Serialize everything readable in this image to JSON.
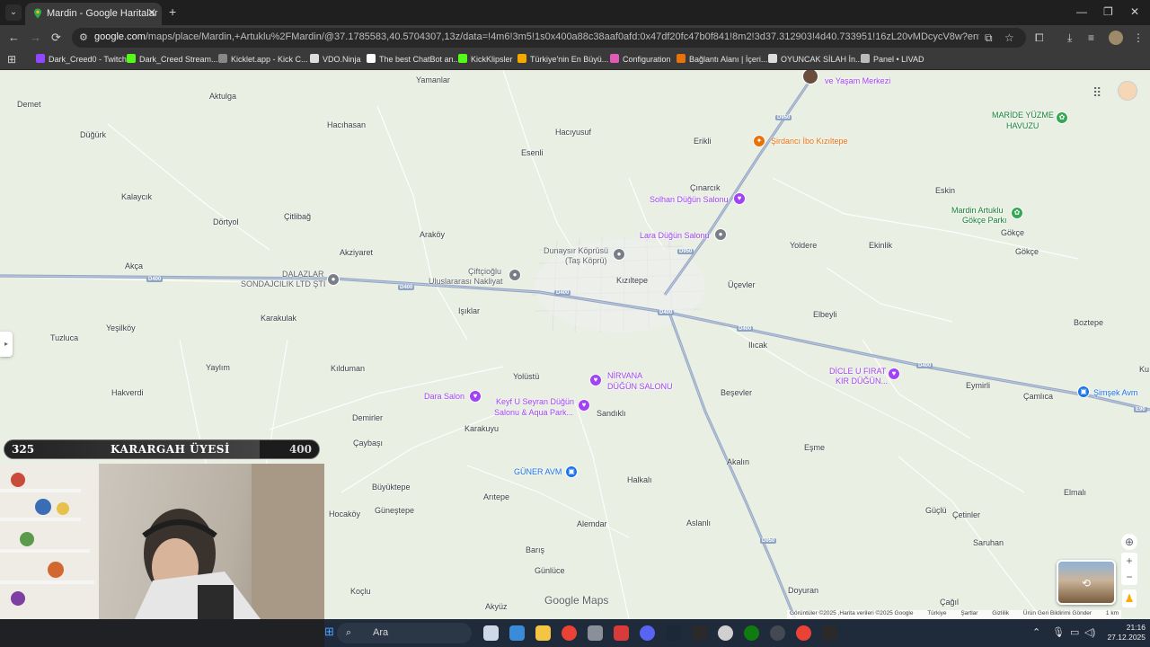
{
  "browser": {
    "tab_title": "Mardin - Google Haritalar",
    "tab_close": "✕",
    "new_tab": "+",
    "url_host": "google.com",
    "url_path": "/maps/place/Mardin,+Artuklu%2FMardin/@37.1785583,40.5704307,13z/data=!4m6!3m5!1s0x400a88c38aaf0afd:0x47df20fc47b0f841!8m2!3d37.312903!4d40.733951!16zL20vMDcycV8w?entry=ttu&g_ep=EgoyMDI1MTIwOS4wI..."
  },
  "bookmarks": [
    {
      "label": "Dark_Creed0 - Twitch",
      "color": "#9146ff"
    },
    {
      "label": "Dark_Creed Stream...",
      "color": "#53fc18"
    },
    {
      "label": "Kicklet.app - Kick C...",
      "color": "#888888"
    },
    {
      "label": "VDO.Ninja",
      "color": "#dddddd"
    },
    {
      "label": "The best ChatBot an...",
      "color": "#ffffff"
    },
    {
      "label": "KickKlipsler",
      "color": "#53fc18"
    },
    {
      "label": "Türkiye'nin En Büyü...",
      "color": "#f2a900"
    },
    {
      "label": "Configuration",
      "color": "#e05ab8"
    },
    {
      "label": "Bağlantı Alanı | İçeri...",
      "color": "#e8710a"
    },
    {
      "label": "OYUNCAK SİLAH İn...",
      "color": "#dddddd"
    },
    {
      "label": "Panel • LIVAD",
      "color": "#bbbbbb"
    }
  ],
  "map": {
    "places": [
      {
        "label": "Yamanlar",
        "cls": ""
      },
      {
        "label": "Aktulga",
        "cls": ""
      },
      {
        "label": "Demet",
        "cls": ""
      },
      {
        "label": "Düğürk",
        "cls": ""
      },
      {
        "label": "Hacıhasan",
        "cls": ""
      },
      {
        "label": "Hacıyusuf",
        "cls": ""
      },
      {
        "label": "Esenli",
        "cls": ""
      },
      {
        "label": "Erikli",
        "cls": ""
      },
      {
        "label": "Kalaycık",
        "cls": ""
      },
      {
        "label": "Dörtyol",
        "cls": ""
      },
      {
        "label": "Çitlibağ",
        "cls": ""
      },
      {
        "label": "Akziyaret",
        "cls": ""
      },
      {
        "label": "Araköy",
        "cls": ""
      },
      {
        "label": "Çınarcık",
        "cls": ""
      },
      {
        "label": "Eskin",
        "cls": ""
      },
      {
        "label": "Gökçe",
        "cls": ""
      },
      {
        "label": "Gökçe",
        "cls": ""
      },
      {
        "label": "Yoldere",
        "cls": ""
      },
      {
        "label": "Ekinlik",
        "cls": ""
      },
      {
        "label": "Akça",
        "cls": ""
      },
      {
        "label": "Kızıltepe",
        "cls": ""
      },
      {
        "label": "Üçevler",
        "cls": ""
      },
      {
        "label": "Işıklar",
        "cls": ""
      },
      {
        "label": "Karakulak",
        "cls": ""
      },
      {
        "label": "Elbeyli",
        "cls": ""
      },
      {
        "label": "Boztepe",
        "cls": ""
      },
      {
        "label": "Yeşilköy",
        "cls": ""
      },
      {
        "label": "Tuzluca",
        "cls": ""
      },
      {
        "label": "Ilıcak",
        "cls": ""
      },
      {
        "label": "Yaylım",
        "cls": ""
      },
      {
        "label": "Kılduman",
        "cls": ""
      },
      {
        "label": "Yolüstü",
        "cls": ""
      },
      {
        "label": "Eymirli",
        "cls": ""
      },
      {
        "label": "Çamlıca",
        "cls": ""
      },
      {
        "label": "Hakverdi",
        "cls": ""
      },
      {
        "label": "Beşevler",
        "cls": ""
      },
      {
        "label": "Sandıklı",
        "cls": ""
      },
      {
        "label": "Demirler",
        "cls": ""
      },
      {
        "label": "Karakuyu",
        "cls": ""
      },
      {
        "label": "Çaybaşı",
        "cls": ""
      },
      {
        "label": "Eşme",
        "cls": ""
      },
      {
        "label": "Akalın",
        "cls": ""
      },
      {
        "label": "Büyüktepe",
        "cls": ""
      },
      {
        "label": "Halkalı",
        "cls": ""
      },
      {
        "label": "Elmalı",
        "cls": ""
      },
      {
        "label": "Arıtepe",
        "cls": ""
      },
      {
        "label": "Hocaköy",
        "cls": ""
      },
      {
        "label": "Güneştepe",
        "cls": ""
      },
      {
        "label": "Güçlü",
        "cls": ""
      },
      {
        "label": "Çetinler",
        "cls": ""
      },
      {
        "label": "Alemdar",
        "cls": ""
      },
      {
        "label": "Aslanlı",
        "cls": ""
      },
      {
        "label": "Barış",
        "cls": ""
      },
      {
        "label": "Saruhan",
        "cls": ""
      },
      {
        "label": "Günlüce",
        "cls": ""
      },
      {
        "label": "Koçlu",
        "cls": ""
      },
      {
        "label": "Doyuran",
        "cls": ""
      },
      {
        "label": "Akyüz",
        "cls": ""
      },
      {
        "label": "Çağıl",
        "cls": ""
      },
      {
        "label": "Ku",
        "cls": ""
      },
      {
        "label": "Dunaysır Köprüsü",
        "cls": "poi-gray"
      },
      {
        "label": "(Taş Köprü)",
        "cls": "poi-gray"
      },
      {
        "label": "Lara Düğün Salonu",
        "cls": "poi-purple"
      },
      {
        "label": "Solhan Düğün Salonu",
        "cls": "poi-purple"
      },
      {
        "label": "Şirdancı İbo Kızıltepe",
        "cls": "poi-orange"
      },
      {
        "label": "Çiftçioğlu",
        "cls": "poi-gray"
      },
      {
        "label": "Uluslararası Nakliyat",
        "cls": "poi-gray"
      },
      {
        "label": "DALAZLAR",
        "cls": "poi-gray"
      },
      {
        "label": "SONDAJCILIK LTD ŞTİ",
        "cls": "poi-gray"
      },
      {
        "label": "NİRVANA",
        "cls": "poi-purple"
      },
      {
        "label": "DÜĞÜN SALONU",
        "cls": "poi-purple"
      },
      {
        "label": "Dara Salon",
        "cls": "poi-purple"
      },
      {
        "label": "Keyf U Seyran Düğün",
        "cls": "poi-purple"
      },
      {
        "label": "Salonu & Aqua Park...",
        "cls": "poi-purple"
      },
      {
        "label": "GÜNER AVM",
        "cls": "poi-blue"
      },
      {
        "label": "DİCLE U FIRAT",
        "cls": "poi-purple"
      },
      {
        "label": "KIR DÜĞÜN...",
        "cls": "poi-purple"
      },
      {
        "label": "Şimşek Avm",
        "cls": "poi-blue"
      },
      {
        "label": "MARİDE YÜZME",
        "cls": "poi-green"
      },
      {
        "label": "HAVUZU",
        "cls": "poi-green"
      },
      {
        "label": "Mardin Artuklu",
        "cls": "poi-green"
      },
      {
        "label": "Gökçe Parkı",
        "cls": "poi-green"
      },
      {
        "label": "ve Yaşam Merkezi",
        "cls": "poi-purple"
      }
    ],
    "road_labels": [
      "D400",
      "D400",
      "D400",
      "D400",
      "D400",
      "D400",
      "D950",
      "D950",
      "D950",
      "E90"
    ],
    "logo": "Google Maps",
    "attribution": [
      "Görüntüler ©2025 ,Harita verileri ©2025 Google",
      "Türkiye",
      "Şartlar",
      "Gizlilik",
      "Ürün Geri Bildirimi Gönder",
      "1 km"
    ]
  },
  "overlay": {
    "goal_current": "325",
    "goal_title": "KARARGAH ÜYESİ",
    "goal_max": "400",
    "goal_fraction": 0.8125
  },
  "taskbar": {
    "search_label": "Ara",
    "time": "21:16",
    "date": "27.12.2025",
    "apps": [
      {
        "name": "task-view",
        "color": "#cfd8e6"
      },
      {
        "name": "store",
        "color": "#3a8bd8"
      },
      {
        "name": "file-explorer",
        "color": "#f4c542"
      },
      {
        "name": "chrome",
        "color": "#ea4335"
      },
      {
        "name": "app-box",
        "color": "#8a8f98"
      },
      {
        "name": "app-red",
        "color": "#d93b3b"
      },
      {
        "name": "discord",
        "color": "#5865f2"
      },
      {
        "name": "steam",
        "color": "#1b2838"
      },
      {
        "name": "epic-games",
        "color": "#2a2a2a"
      },
      {
        "name": "openai",
        "color": "#d0d0d0"
      },
      {
        "name": "xbox",
        "color": "#107c10"
      },
      {
        "name": "obs",
        "color": "#444a54"
      },
      {
        "name": "chrome-active",
        "color": "#ea4335"
      },
      {
        "name": "epic-games-2",
        "color": "#2a2a2a"
      }
    ]
  }
}
